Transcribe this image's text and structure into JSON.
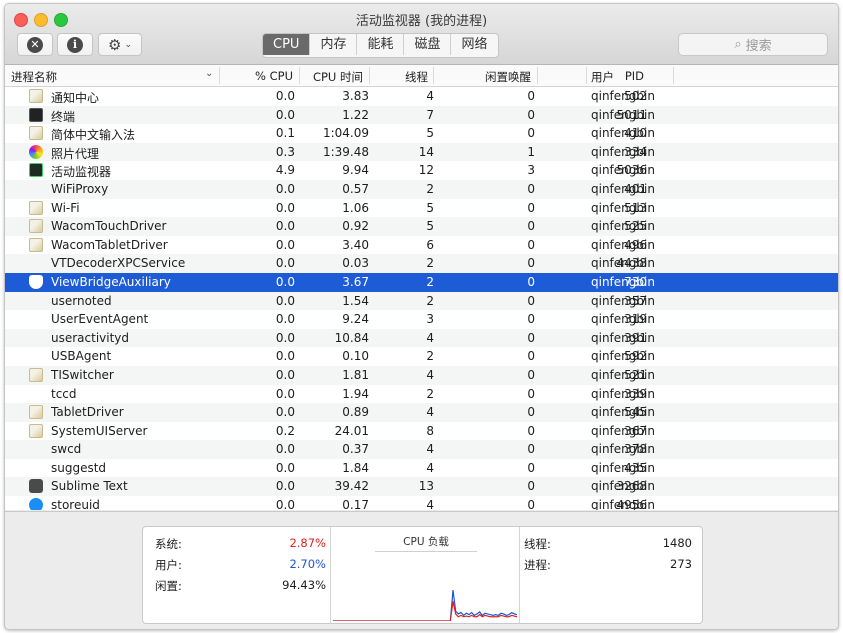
{
  "window": {
    "title": "活动监视器 (我的进程)",
    "tabs": [
      {
        "label": "CPU",
        "active": true
      },
      {
        "label": "内存",
        "active": false
      },
      {
        "label": "能耗",
        "active": false
      },
      {
        "label": "磁盘",
        "active": false
      },
      {
        "label": "网络",
        "active": false
      }
    ],
    "search_placeholder": "搜索"
  },
  "columns": {
    "name": "进程名称",
    "cpu": "% CPU",
    "cpu_time": "CPU 时间",
    "threads": "线程",
    "idle_wake": "闲置唤醒",
    "pid": "PID",
    "user": "用户"
  },
  "processes": [
    {
      "name": "通知中心",
      "cpu": "0.0",
      "time": "3.83",
      "threads": "4",
      "wake": "0",
      "pid": "502",
      "user": "qinfengbin",
      "icon": "generic-app-icon"
    },
    {
      "name": "终端",
      "cpu": "0.0",
      "time": "1.22",
      "threads": "7",
      "wake": "0",
      "pid": "5011",
      "user": "qinfengbin",
      "icon": "terminal-icon"
    },
    {
      "name": "简体中文输入法",
      "cpu": "0.1",
      "time": "1:04.09",
      "threads": "5",
      "wake": "0",
      "pid": "410",
      "user": "qinfengbin",
      "icon": "generic-app-icon"
    },
    {
      "name": "照片代理",
      "cpu": "0.3",
      "time": "1:39.48",
      "threads": "14",
      "wake": "1",
      "pid": "334",
      "user": "qinfengbin",
      "icon": "photos-icon"
    },
    {
      "name": "活动监视器",
      "cpu": "4.9",
      "time": "9.94",
      "threads": "12",
      "wake": "3",
      "pid": "5036",
      "user": "qinfengbin",
      "icon": "activity-monitor-icon"
    },
    {
      "name": "WiFiProxy",
      "cpu": "0.0",
      "time": "0.57",
      "threads": "2",
      "wake": "0",
      "pid": "401",
      "user": "qinfengbin",
      "icon": ""
    },
    {
      "name": "Wi-Fi",
      "cpu": "0.0",
      "time": "1.06",
      "threads": "5",
      "wake": "0",
      "pid": "513",
      "user": "qinfengbin",
      "icon": "generic-app-icon"
    },
    {
      "name": "WacomTouchDriver",
      "cpu": "0.0",
      "time": "0.92",
      "threads": "5",
      "wake": "0",
      "pid": "525",
      "user": "qinfengbin",
      "icon": "generic-app-icon"
    },
    {
      "name": "WacomTabletDriver",
      "cpu": "0.0",
      "time": "3.40",
      "threads": "6",
      "wake": "0",
      "pid": "496",
      "user": "qinfengbin",
      "icon": "generic-app-icon"
    },
    {
      "name": "VTDecoderXPCService",
      "cpu": "0.0",
      "time": "0.03",
      "threads": "2",
      "wake": "0",
      "pid": "4438",
      "user": "qinfengbin",
      "icon": ""
    },
    {
      "name": "ViewBridgeAuxiliary",
      "cpu": "0.0",
      "time": "3.67",
      "threads": "2",
      "wake": "0",
      "pid": "730",
      "user": "qinfengbin",
      "icon": "shield-icon",
      "selected": true
    },
    {
      "name": "usernoted",
      "cpu": "0.0",
      "time": "1.54",
      "threads": "2",
      "wake": "0",
      "pid": "357",
      "user": "qinfengbin",
      "icon": ""
    },
    {
      "name": "UserEventAgent",
      "cpu": "0.0",
      "time": "9.24",
      "threads": "3",
      "wake": "0",
      "pid": "319",
      "user": "qinfengbin",
      "icon": ""
    },
    {
      "name": "useractivityd",
      "cpu": "0.0",
      "time": "10.84",
      "threads": "4",
      "wake": "0",
      "pid": "391",
      "user": "qinfengbin",
      "icon": ""
    },
    {
      "name": "USBAgent",
      "cpu": "0.0",
      "time": "0.10",
      "threads": "2",
      "wake": "0",
      "pid": "592",
      "user": "qinfengbin",
      "icon": ""
    },
    {
      "name": "TISwitcher",
      "cpu": "0.0",
      "time": "1.81",
      "threads": "4",
      "wake": "0",
      "pid": "521",
      "user": "qinfengbin",
      "icon": "generic-app-icon"
    },
    {
      "name": "tccd",
      "cpu": "0.0",
      "time": "1.94",
      "threads": "2",
      "wake": "0",
      "pid": "339",
      "user": "qinfengbin",
      "icon": ""
    },
    {
      "name": "TabletDriver",
      "cpu": "0.0",
      "time": "0.89",
      "threads": "4",
      "wake": "0",
      "pid": "545",
      "user": "qinfengbin",
      "icon": "generic-app-icon"
    },
    {
      "name": "SystemUIServer",
      "cpu": "0.2",
      "time": "24.01",
      "threads": "8",
      "wake": "0",
      "pid": "367",
      "user": "qinfengbin",
      "icon": "generic-app-icon"
    },
    {
      "name": "swcd",
      "cpu": "0.0",
      "time": "0.37",
      "threads": "4",
      "wake": "0",
      "pid": "378",
      "user": "qinfengbin",
      "icon": ""
    },
    {
      "name": "suggestd",
      "cpu": "0.0",
      "time": "1.84",
      "threads": "4",
      "wake": "0",
      "pid": "435",
      "user": "qinfengbin",
      "icon": ""
    },
    {
      "name": "Sublime Text",
      "cpu": "0.0",
      "time": "39.42",
      "threads": "13",
      "wake": "0",
      "pid": "3268",
      "user": "qinfengbin",
      "icon": "sublime-text-icon"
    },
    {
      "name": "storeuid",
      "cpu": "0.0",
      "time": "0.17",
      "threads": "4",
      "wake": "0",
      "pid": "4956",
      "user": "qinfengbin",
      "icon": "app-store-icon"
    }
  ],
  "summary": {
    "system_label": "系统:",
    "system_value": "2.87%",
    "user_label": "用户:",
    "user_value": "2.70%",
    "idle_label": "闲置:",
    "idle_value": "94.43%",
    "chart_title": "CPU 负载",
    "threads_label": "线程:",
    "threads_value": "1480",
    "processes_label": "进程:",
    "processes_value": "273",
    "system_color": "#e02020",
    "user_color": "#2055d0"
  },
  "cpu_load_history": {
    "system": [
      0.0,
      0.0,
      0.0,
      0.0,
      0.0,
      0.0,
      0.0,
      0.0,
      0.0,
      0.0,
      0.0,
      0.0,
      0.0,
      0.0,
      0.0,
      0.0,
      0.0,
      0.0,
      0.0,
      0.0,
      0.0,
      0.0,
      0.0,
      0.0,
      0.0,
      0.0,
      0.0,
      0.0,
      0.0,
      0.0,
      0.0,
      0.0,
      0.0,
      0.0,
      0.0,
      0.0,
      0.0,
      0.0,
      0.0,
      0.0,
      0.0,
      0.0,
      0.0,
      0.0,
      0.0,
      0.14,
      0.05,
      0.03,
      0.04,
      0.03,
      0.035,
      0.03,
      0.04,
      0.03,
      0.03,
      0.045,
      0.03,
      0.04,
      0.035,
      0.03,
      0.03,
      0.03,
      0.03,
      0.04,
      0.035,
      0.03,
      0.03,
      0.04,
      0.035,
      0.03
    ],
    "user": [
      0.0,
      0.0,
      0.0,
      0.0,
      0.0,
      0.0,
      0.0,
      0.0,
      0.0,
      0.0,
      0.0,
      0.0,
      0.0,
      0.0,
      0.0,
      0.0,
      0.0,
      0.0,
      0.0,
      0.0,
      0.0,
      0.0,
      0.0,
      0.0,
      0.0,
      0.0,
      0.0,
      0.0,
      0.0,
      0.0,
      0.0,
      0.0,
      0.0,
      0.0,
      0.0,
      0.0,
      0.0,
      0.0,
      0.0,
      0.0,
      0.0,
      0.0,
      0.0,
      0.0,
      0.0,
      0.22,
      0.07,
      0.05,
      0.06,
      0.04,
      0.055,
      0.045,
      0.06,
      0.04,
      0.05,
      0.065,
      0.04,
      0.055,
      0.05,
      0.045,
      0.04,
      0.045,
      0.04,
      0.055,
      0.05,
      0.04,
      0.045,
      0.06,
      0.05,
      0.045
    ]
  }
}
